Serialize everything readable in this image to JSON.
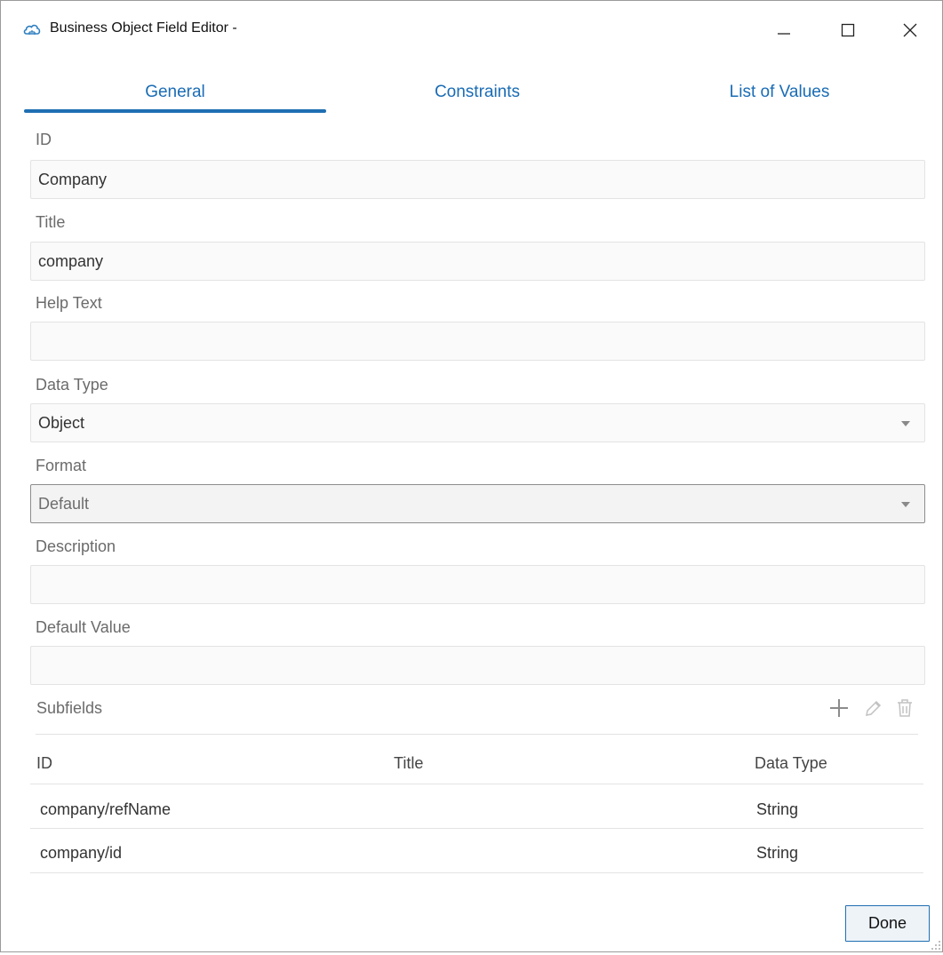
{
  "window": {
    "title": "Business Object Field Editor -"
  },
  "tabs": [
    {
      "label": "General",
      "active": true
    },
    {
      "label": "Constraints",
      "active": false
    },
    {
      "label": "List of Values",
      "active": false
    }
  ],
  "form": {
    "id": {
      "label": "ID",
      "value": "Company"
    },
    "title": {
      "label": "Title",
      "value": "company"
    },
    "help_text": {
      "label": "Help Text",
      "value": ""
    },
    "data_type": {
      "label": "Data Type",
      "value": "Object"
    },
    "format": {
      "label": "Format",
      "value": "Default",
      "disabled": true
    },
    "description": {
      "label": "Description",
      "value": ""
    },
    "default_value": {
      "label": "Default Value",
      "value": ""
    }
  },
  "subfields": {
    "label": "Subfields",
    "actions": [
      "add-icon",
      "edit-icon",
      "delete-icon"
    ],
    "columns": [
      "ID",
      "Title",
      "Data Type"
    ],
    "rows": [
      {
        "id": "company/refName",
        "title": "",
        "data_type": "String"
      },
      {
        "id": "company/id",
        "title": "",
        "data_type": "String"
      }
    ]
  },
  "footer": {
    "done_label": "Done"
  },
  "colors": {
    "accent": "#1f6fb2",
    "tab_text": "#1a6cb5"
  }
}
